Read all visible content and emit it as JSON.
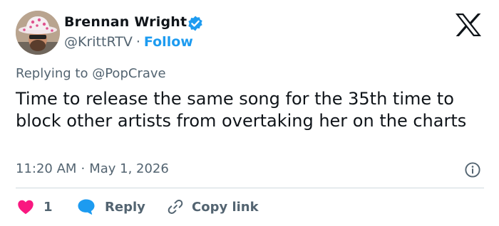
{
  "author": {
    "display_name": "Brennan Wright",
    "handle": "@KrittRTV",
    "separator": "·",
    "follow_label": "Follow"
  },
  "reply": {
    "prefix": "Replying to",
    "mention": "@PopCrave"
  },
  "tweet": {
    "text": "Time to release the same song for the 35th time to block other artists from overtaking her on the charts"
  },
  "meta": {
    "time": "11:20 AM",
    "separator": "·",
    "date": "May 1, 2026"
  },
  "actions": {
    "like_count": "1",
    "reply_label": "Reply",
    "copy_label": "Copy link"
  },
  "icons": {
    "verified": "verified-badge-icon",
    "brand": "x-logo-icon",
    "info": "info-icon",
    "like": "heart-icon",
    "reply": "chat-bubble-icon",
    "copy": "link-icon"
  },
  "colors": {
    "text": "#0f1419",
    "secondary": "#536471",
    "accent": "#1d9bf0",
    "like": "#f91880",
    "divider": "#cfd9de"
  }
}
